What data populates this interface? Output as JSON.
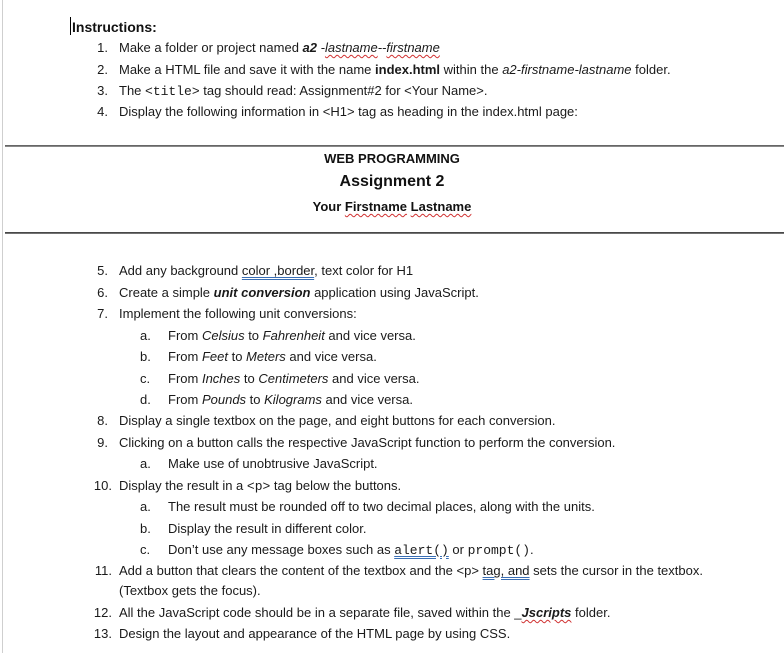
{
  "document": {
    "heading": "Instructions:",
    "items": [
      {
        "num": "1.",
        "parts": [
          {
            "t": "Make a folder or project named "
          },
          {
            "t": "a2",
            "style": "bi"
          },
          {
            "t": " -",
            "style": "i"
          },
          {
            "t": "lastname",
            "style": "i spell"
          },
          {
            "t": "--",
            "style": "i"
          },
          {
            "t": "firstname",
            "style": "i spell"
          }
        ]
      },
      {
        "num": "2.",
        "parts": [
          {
            "t": "Make a HTML file and save it with the name "
          },
          {
            "t": "index.html",
            "style": "b"
          },
          {
            "t": " within the "
          },
          {
            "t": "a2-firstname-lastname",
            "style": "i"
          },
          {
            "t": " folder."
          }
        ]
      },
      {
        "num": "3.",
        "parts": [
          {
            "t": "The "
          },
          {
            "t": "<title>",
            "style": "mono"
          },
          {
            "t": " tag should read:   Assignment#2 for <Your Name>."
          }
        ]
      },
      {
        "num": "4.",
        "parts": [
          {
            "t": "Display the following information in <H1> tag as heading in the index.html page:"
          }
        ]
      }
    ],
    "h1_preview": {
      "line1": "WEB PROGRAMMING",
      "line2": "Assignment 2",
      "line3_prefix": "Your ",
      "line3_first": "Firstname",
      "line3_space": " ",
      "line3_last": "Lastname"
    },
    "items2": [
      {
        "num": "5.",
        "level": 1,
        "parts": [
          {
            "t": "Add any background "
          },
          {
            "t": "color ,border",
            "style": "grammar"
          },
          {
            "t": ", text color    for H1"
          }
        ]
      },
      {
        "num": "6.",
        "level": 1,
        "parts": [
          {
            "t": "Create a simple "
          },
          {
            "t": "unit conversion",
            "style": "bi"
          },
          {
            "t": " application using JavaScript."
          }
        ]
      },
      {
        "num": "7.",
        "level": 1,
        "parts": [
          {
            "t": "Implement the following unit conversions:"
          }
        ]
      },
      {
        "num": "a.",
        "level": 2,
        "parts": [
          {
            "t": "From "
          },
          {
            "t": "Celsius",
            "style": "i"
          },
          {
            "t": " to "
          },
          {
            "t": "Fahrenheit",
            "style": "i"
          },
          {
            "t": " and vice versa."
          }
        ]
      },
      {
        "num": "b.",
        "level": 2,
        "parts": [
          {
            "t": "From "
          },
          {
            "t": "Feet",
            "style": "i"
          },
          {
            "t": " to "
          },
          {
            "t": "Meters",
            "style": "i"
          },
          {
            "t": " and vice versa."
          }
        ]
      },
      {
        "num": "c.",
        "level": 2,
        "parts": [
          {
            "t": "From "
          },
          {
            "t": "Inches",
            "style": "i"
          },
          {
            "t": " to "
          },
          {
            "t": "Centimeters",
            "style": "i"
          },
          {
            "t": " and vice versa."
          }
        ]
      },
      {
        "num": "d.",
        "level": 2,
        "parts": [
          {
            "t": "From "
          },
          {
            "t": "Pounds",
            "style": "i"
          },
          {
            "t": " to "
          },
          {
            "t": "Kilograms",
            "style": "i"
          },
          {
            "t": " and vice versa."
          }
        ]
      },
      {
        "num": "8.",
        "level": 1,
        "parts": [
          {
            "t": "Display a single textbox on the page, and eight buttons for each conversion."
          }
        ]
      },
      {
        "num": "9.",
        "level": 1,
        "parts": [
          {
            "t": "Clicking on a button calls the respective JavaScript function to perform the conversion."
          }
        ]
      },
      {
        "num": "a.",
        "level": 2,
        "parts": [
          {
            "t": "Make use of unobtrusive JavaScript."
          }
        ]
      },
      {
        "num": "10.",
        "level": 1,
        "parts": [
          {
            "t": "Display the result in a "
          },
          {
            "t": "<p>",
            "style": "mono"
          },
          {
            "t": " tag below the buttons."
          }
        ]
      },
      {
        "num": "a.",
        "level": 2,
        "parts": [
          {
            "t": "The result must be rounded off to two decimal places, along with the units."
          }
        ]
      },
      {
        "num": "b.",
        "level": 2,
        "parts": [
          {
            "t": "Display the result in different color."
          }
        ]
      },
      {
        "num": "c.",
        "level": 2,
        "parts": [
          {
            "t": "Don’t use any message boxes such as "
          },
          {
            "t": "alert()",
            "style": "mono grammar"
          },
          {
            "t": " or "
          },
          {
            "t": "prompt()",
            "style": "mono"
          },
          {
            "t": "."
          }
        ]
      },
      {
        "num": "11.",
        "level": 1,
        "parts": [
          {
            "t": "Add a button that clears the content of the textbox and the <p> "
          },
          {
            "t": "tag, and",
            "style": "grammar"
          },
          {
            "t": " sets the cursor in the textbox."
          }
        ]
      },
      {
        "num": "",
        "level": 1,
        "parts": [
          {
            "t": "(Textbox gets the focus)."
          }
        ]
      },
      {
        "num": "12.",
        "level": 1,
        "parts": [
          {
            "t": "All the JavaScript code should be in a separate file, saved within the _"
          },
          {
            "t": "Jscripts",
            "style": "bi spell"
          },
          {
            "t": " folder."
          }
        ]
      },
      {
        "num": "13.",
        "level": 1,
        "parts": [
          {
            "t": "Design the layout and appearance of the HTML page by using CSS."
          }
        ]
      }
    ]
  },
  "colors": {
    "text": "#1a1a1a",
    "spellcheck": "#d03030",
    "grammarcheck": "#3a6fb5"
  }
}
